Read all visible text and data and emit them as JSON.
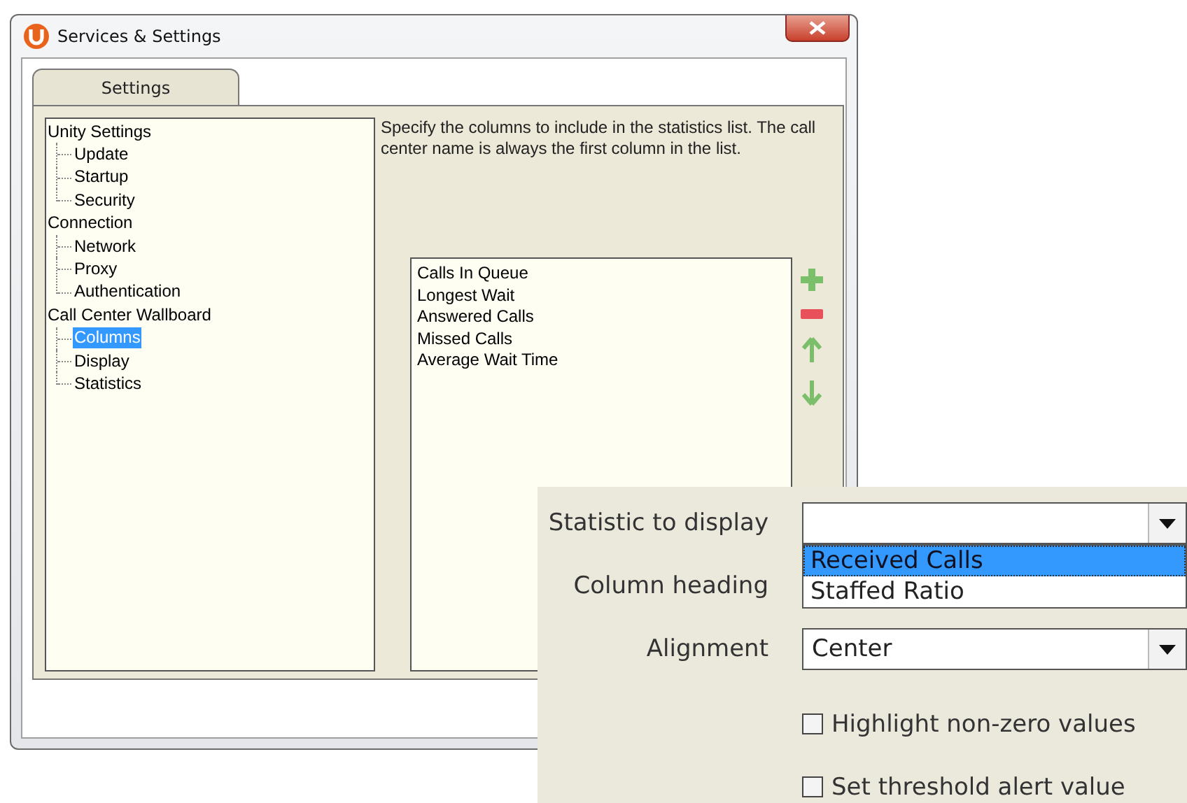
{
  "window": {
    "title": "Services & Settings"
  },
  "tabs": [
    {
      "label": "Settings"
    }
  ],
  "tree": [
    {
      "label": "Unity Settings",
      "selected": false,
      "children": [
        {
          "label": "Update",
          "selected": false
        },
        {
          "label": "Startup",
          "selected": false
        },
        {
          "label": "Security",
          "selected": false
        }
      ]
    },
    {
      "label": "Connection",
      "selected": false,
      "children": [
        {
          "label": "Network",
          "selected": false
        },
        {
          "label": "Proxy",
          "selected": false
        },
        {
          "label": "Authentication",
          "selected": false
        }
      ]
    },
    {
      "label": "Call Center Wallboard",
      "selected": false,
      "children": [
        {
          "label": "Columns",
          "selected": true
        },
        {
          "label": "Display",
          "selected": false
        },
        {
          "label": "Statistics",
          "selected": false
        }
      ]
    }
  ],
  "description": "Specify the columns to include in the statistics list.  The call center name is always the first column in the list.",
  "columns_list": [
    "Calls In Queue",
    "Longest Wait",
    "Answered Calls",
    "Missed Calls",
    "Average Wait Time"
  ],
  "column_editor": {
    "rows": [
      {
        "kind": "dropdown",
        "label": "Statistic to display",
        "options": [
          {
            "label": "Received Calls",
            "selected": true
          },
          {
            "label": "Staffed Ratio",
            "selected": false
          }
        ]
      },
      {
        "kind": "text",
        "label": "Column heading"
      },
      {
        "kind": "dropdown",
        "label": "Alignment",
        "value": "Center"
      },
      {
        "kind": "checkbox",
        "label": "Highlight non-zero values",
        "checked": false
      },
      {
        "kind": "checkbox",
        "label": "Set threshold alert value",
        "checked": false
      }
    ]
  }
}
